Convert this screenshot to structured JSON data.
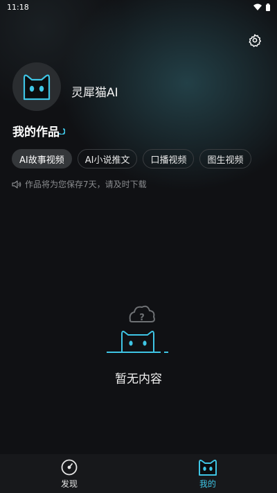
{
  "status_bar": {
    "time": "11:18",
    "icons": [
      "wifi-icon",
      "battery-icon"
    ]
  },
  "profile": {
    "name": "灵犀猫AI",
    "avatar": "cat-avatar"
  },
  "section": {
    "title": "我的作品"
  },
  "tabs": [
    {
      "label": "AI故事视频",
      "active": true
    },
    {
      "label": "AI小说推文",
      "active": false
    },
    {
      "label": "口播视频",
      "active": false
    },
    {
      "label": "图生视频",
      "active": false
    }
  ],
  "notice": {
    "icon": "speaker-icon",
    "text": "作品将为您保存7天，请及时下载"
  },
  "empty_state": {
    "text": "暂无内容",
    "icon": "cat-cloud-question-icon"
  },
  "bottom_nav": [
    {
      "label": "发现",
      "icon": "compass-icon",
      "active": false
    },
    {
      "label": "我的",
      "icon": "cat-face-icon",
      "active": true
    }
  ],
  "colors": {
    "accent": "#3fc6e6",
    "background": "#101114",
    "nav_background": "#17181b"
  }
}
